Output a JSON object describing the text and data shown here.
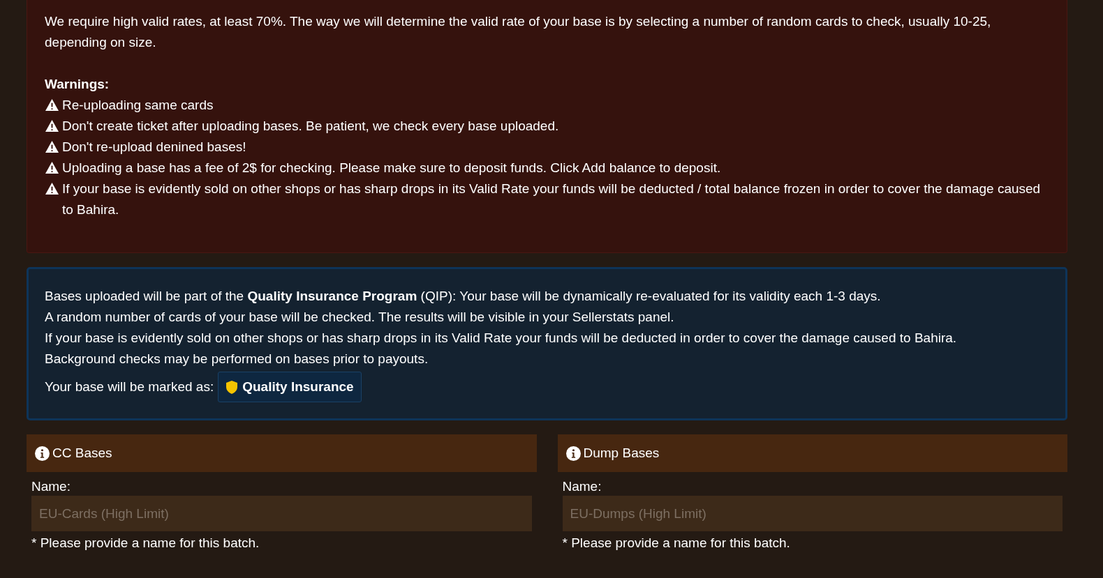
{
  "rules": {
    "intro": "We require high valid rates, at least 70%. The way we will determine the valid rate of your base is by selecting a number of random cards to check, usually 10-25, depending on size.",
    "warnings_title": "Warnings:",
    "warnings": [
      "Re-uploading same cards",
      "Don't create ticket after uploading bases. Be patient, we check every base uploaded.",
      "Don't re-upload denined bases!",
      "Uploading a base has a fee of 2$ for checking. Please make sure to deposit funds. Click Add balance to deposit.",
      "If your base is evidently sold on other shops or has sharp drops in its Valid Rate your funds will be deducted / total balance frozen in order to cover the damage caused to Bahira."
    ]
  },
  "qip": {
    "lines": [
      "Bases uploaded will be part of the **Quality Insurance Program** (QIP): Your base will be dynamically re-evaluated for its validity each 1-3 days.",
      "A random number of cards of your base will be checked. The results will be visible in your Sellerstats panel.",
      "If your base is evidently sold on other shops or has sharp drops in its Valid Rate your funds will be deducted in order to cover the damage caused to Bahira.",
      "Background checks may be performed on bases prior to payouts."
    ],
    "marked_label": "Your base will be marked as:",
    "badge": "Quality Insurance"
  },
  "forms": [
    {
      "title": "CC Bases",
      "label": "Name:",
      "placeholder": "EU-Cards (High Limit)",
      "hint": "* Please provide a name for this batch."
    },
    {
      "title": "Dump Bases",
      "label": "Name:",
      "placeholder": "EU-Dumps (High Limit)",
      "hint": "* Please provide a name for this batch."
    }
  ]
}
